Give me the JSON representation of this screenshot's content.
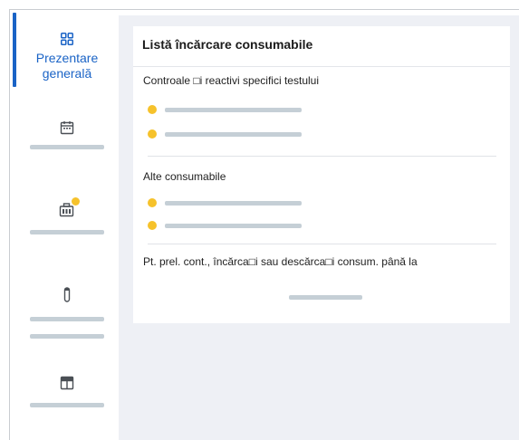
{
  "sidebar": {
    "items": [
      {
        "icon": "grid-icon",
        "label": "Prezentare generală",
        "active": true
      },
      {
        "icon": "calendar-icon",
        "label": ""
      },
      {
        "icon": "bag-icon",
        "label": "",
        "badge": true
      },
      {
        "icon": "tube-icon",
        "label": ""
      },
      {
        "icon": "window-icon",
        "label": ""
      }
    ]
  },
  "card": {
    "title": "Listă încărcare consumabile",
    "section1": "Controale □i reactivi specifici testului",
    "section2": "Alte consumabile",
    "footer": "Pt. prel. cont., încărca□i sau descărca□i consum. până la"
  },
  "colors": {
    "accent": "#1a63c6",
    "status_dot": "#f6c22b",
    "placeholder": "#c5cfd6",
    "background": "#eef0f5"
  }
}
